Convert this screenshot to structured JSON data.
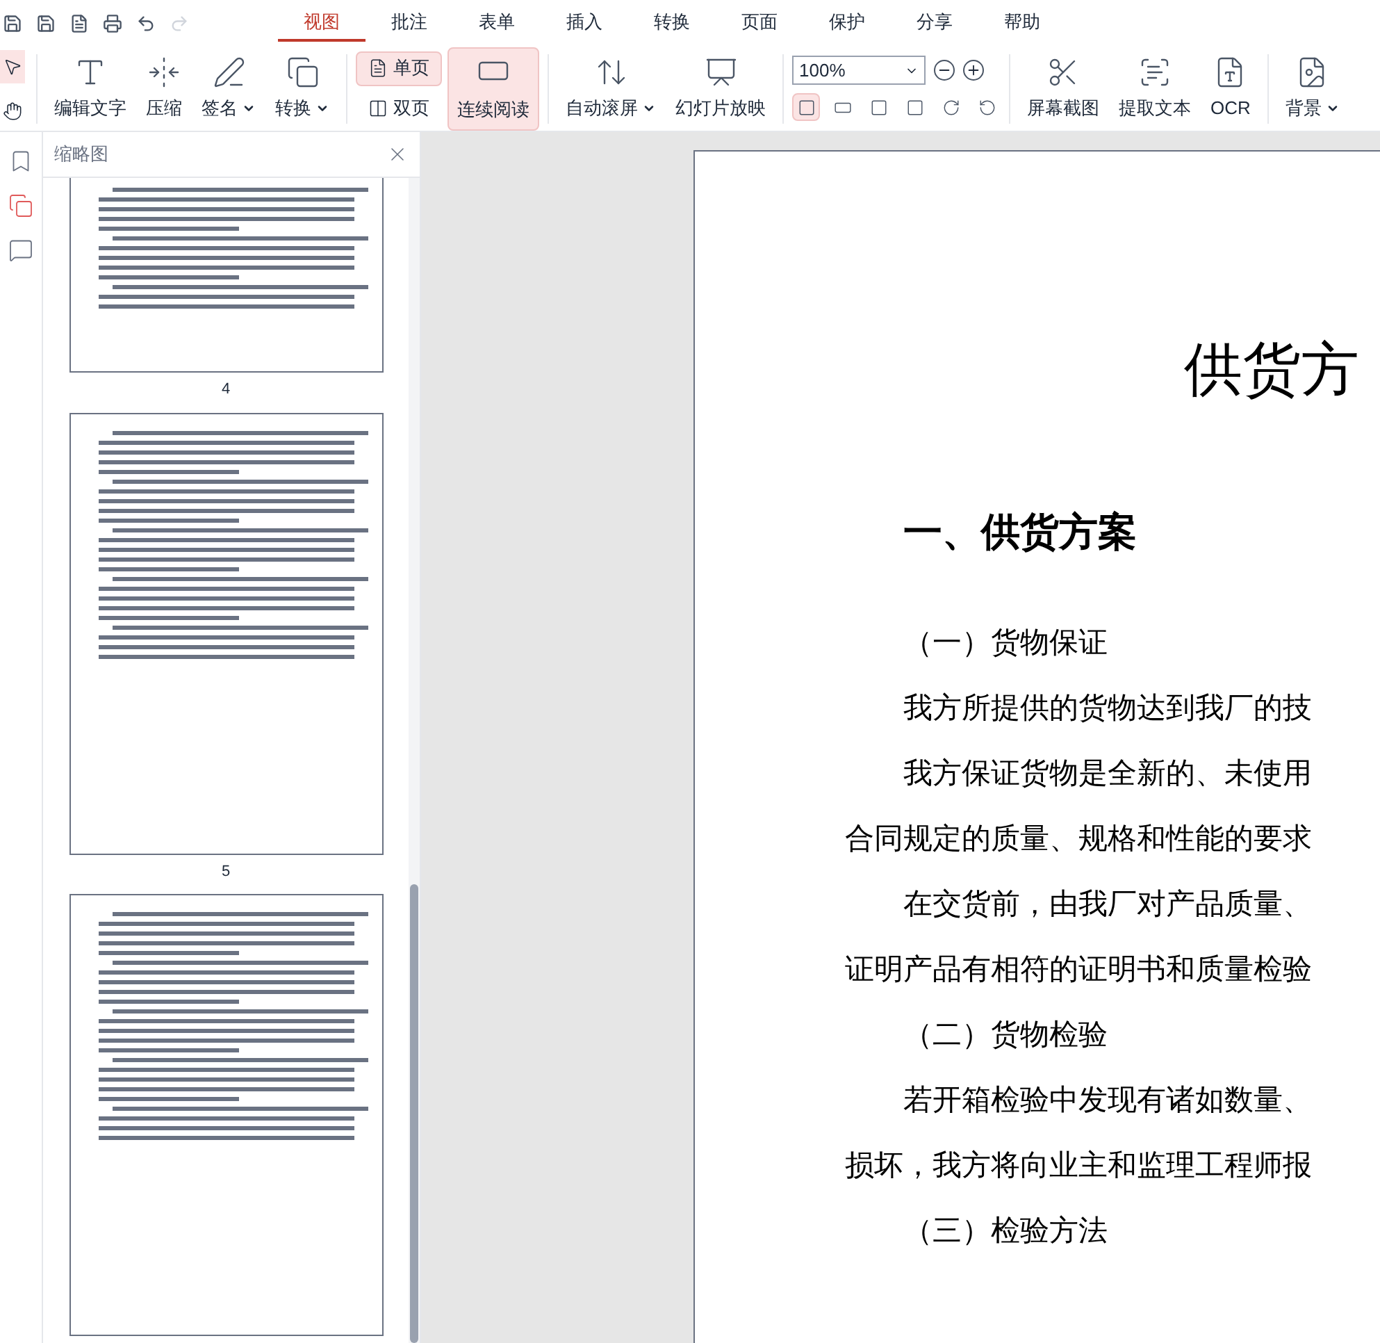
{
  "menu_tabs": [
    {
      "label": "视图",
      "selected": true
    },
    {
      "label": "批注",
      "selected": false
    },
    {
      "label": "表单",
      "selected": false
    },
    {
      "label": "插入",
      "selected": false
    },
    {
      "label": "转换",
      "selected": false
    },
    {
      "label": "页面",
      "selected": false
    },
    {
      "label": "保护",
      "selected": false
    },
    {
      "label": "分享",
      "selected": false
    },
    {
      "label": "帮助",
      "selected": false
    }
  ],
  "pointer_tools": [
    {
      "kind": "select",
      "selected": true
    },
    {
      "kind": "hand",
      "selected": false
    }
  ],
  "tool_groups": [
    [
      {
        "kind": "edit-text",
        "label": "编辑文字",
        "dropdown": false,
        "selected": false
      },
      {
        "kind": "compress",
        "label": "压缩",
        "dropdown": false,
        "selected": false
      },
      {
        "kind": "sign",
        "label": "签名",
        "dropdown": true,
        "selected": false
      },
      {
        "kind": "convert",
        "label": "转换",
        "dropdown": true,
        "selected": false
      }
    ],
    [
      {
        "kind": "view-mode"
      }
    ],
    [
      {
        "kind": "auto-scroll",
        "label": "自动滚屏",
        "dropdown": true,
        "selected": false
      },
      {
        "kind": "slideshow",
        "label": "幻灯片放映",
        "dropdown": false,
        "selected": false
      }
    ],
    [
      {
        "kind": "zoom"
      }
    ],
    [
      {
        "kind": "screenshot",
        "label": "屏幕截图",
        "dropdown": false,
        "selected": false
      },
      {
        "kind": "extract",
        "label": "提取文本",
        "dropdown": false,
        "selected": false
      },
      {
        "kind": "ocr",
        "label": "OCR",
        "dropdown": false,
        "selected": false
      }
    ],
    [
      {
        "kind": "background",
        "label": "背景",
        "dropdown": true,
        "selected": false
      }
    ]
  ],
  "view_modes": {
    "single": {
      "label": "单页",
      "selected": true
    },
    "double": {
      "label": "双页",
      "selected": false
    },
    "continuous": {
      "label": "连续阅读",
      "selected": true
    }
  },
  "zoom": {
    "value": "100%"
  },
  "fit_buttons": [
    {
      "kind": "fit-page",
      "selected": true
    },
    {
      "kind": "fit-width",
      "selected": false
    },
    {
      "kind": "fit-height",
      "selected": false
    },
    {
      "kind": "fit-visible",
      "selected": false
    },
    {
      "kind": "rotate-right",
      "selected": false
    },
    {
      "kind": "rotate-left",
      "selected": false
    }
  ],
  "side_icons": [
    {
      "kind": "bookmark",
      "selected": false
    },
    {
      "kind": "thumbnails",
      "selected": true
    },
    {
      "kind": "comment",
      "selected": false
    }
  ],
  "thumbnail_panel": {
    "title": "缩略图",
    "pages": [
      {
        "number": "4"
      },
      {
        "number": "5"
      }
    ]
  },
  "document": {
    "title": "供货方",
    "heading": "一、供货方案",
    "paragraphs": [
      {
        "kind": "subheading",
        "text": "（一）货物保证"
      },
      {
        "kind": "indent",
        "text": "我方所提供的货物达到我厂的技"
      },
      {
        "kind": "indent",
        "text": "我方保证货物是全新的、未使用"
      },
      {
        "kind": "plain",
        "text": "合同规定的质量、规格和性能的要求"
      },
      {
        "kind": "indent",
        "text": "在交货前，由我厂对产品质量、"
      },
      {
        "kind": "plain",
        "text": "证明产品有相符的证明书和质量检验"
      },
      {
        "kind": "subheading",
        "text": "（二）货物检验"
      },
      {
        "kind": "indent",
        "text": "若开箱检验中发现有诸如数量、"
      },
      {
        "kind": "plain",
        "text": "损坏，我方将向业主和监理工程师报"
      },
      {
        "kind": "subheading",
        "text": "（三）检验方法"
      }
    ]
  }
}
